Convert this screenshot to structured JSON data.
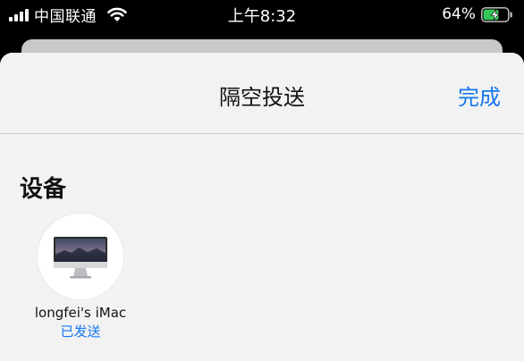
{
  "status_bar": {
    "carrier": "中国联通",
    "time": "上午8:32",
    "battery_percent": "64%",
    "battery_level": 0.64,
    "charging": true
  },
  "sheet": {
    "title": "隔空投送",
    "done_label": "完成",
    "section_title": "设备"
  },
  "devices": [
    {
      "name": "longfei's iMac",
      "status": "已发送",
      "icon": "imac-icon"
    }
  ],
  "colors": {
    "accent": "#1477f0",
    "sheet_bg": "#f2f2f2",
    "status_bg": "#000000"
  }
}
